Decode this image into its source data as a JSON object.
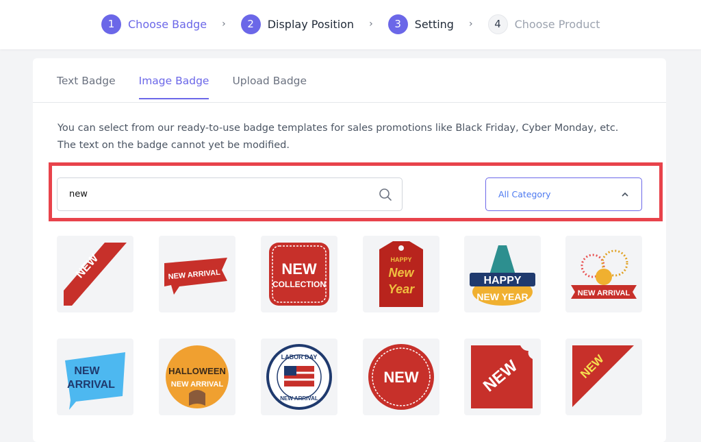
{
  "steps": [
    {
      "num": "1",
      "label": "Choose Badge",
      "state": "active"
    },
    {
      "num": "2",
      "label": "Display Position",
      "state": "done"
    },
    {
      "num": "3",
      "label": "Setting",
      "state": "done"
    },
    {
      "num": "4",
      "label": "Choose Product",
      "state": "off"
    }
  ],
  "tabs": [
    {
      "label": "Text Badge"
    },
    {
      "label": "Image Badge",
      "active": true
    },
    {
      "label": "Upload Badge"
    }
  ],
  "description": {
    "line1": "You can select from our ready-to-use badge templates for sales promotions like Black Friday, Cyber Monday, etc.",
    "line2": "The text on the badge cannot yet be modified."
  },
  "search": {
    "value": "new",
    "icon": "search-icon"
  },
  "category": {
    "selected": "All Category",
    "icon": "chevron-up-icon"
  },
  "colors": {
    "accent": "#6b67e8",
    "highlight": "#e8434b",
    "badge_red": "#c7302a"
  },
  "badges": [
    {
      "kind": "corner-ribbon",
      "text": [
        "NEW"
      ]
    },
    {
      "kind": "banner",
      "text": [
        "NEW ARRIVAL"
      ]
    },
    {
      "kind": "stamp",
      "text": [
        "NEW",
        "COLLECTION"
      ]
    },
    {
      "kind": "tag",
      "text": [
        "HAPPY",
        "New",
        "Year"
      ]
    },
    {
      "kind": "happy-new-year",
      "text": [
        "HAPPY",
        "NEW YEAR"
      ]
    },
    {
      "kind": "fireworks",
      "text": [
        "NEW ARRIVAL"
      ]
    },
    {
      "kind": "speech",
      "text": [
        "NEW",
        "ARRIVAL"
      ]
    },
    {
      "kind": "halloween",
      "text": [
        "HALLOWEEN",
        "NEW ARRIVAL"
      ]
    },
    {
      "kind": "labor-day",
      "text": [
        "LABOR DAY",
        "NEW ARRIVAL"
      ]
    },
    {
      "kind": "circle",
      "text": [
        "NEW"
      ]
    },
    {
      "kind": "scallop",
      "text": [
        "NEW"
      ]
    },
    {
      "kind": "triangle",
      "text": [
        "NEW"
      ]
    }
  ]
}
